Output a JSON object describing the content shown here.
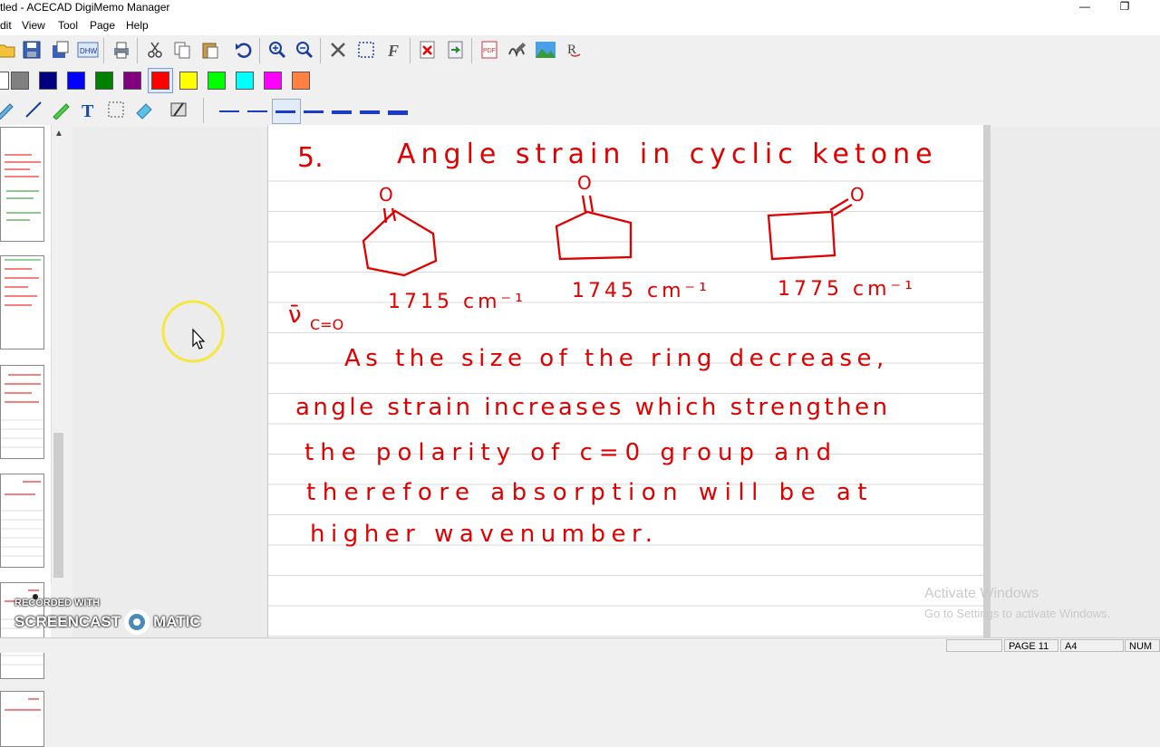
{
  "window": {
    "title": "tled - ACECAD DigiMemo Manager",
    "minimize": "—",
    "restore": "❐"
  },
  "menu": [
    "dit",
    "View",
    "Tool",
    "Page",
    "Help"
  ],
  "toolbar_icons": [
    "open-icon",
    "save-icon",
    "saveas-icon",
    "dhw-icon",
    "print-icon",
    "cut-icon",
    "copy-icon",
    "paste-icon",
    "undo-icon",
    "zoom-in-icon",
    "zoom-out-icon",
    "delete-icon",
    "select-icon",
    "font-icon",
    "close-file-icon",
    "export-icon",
    "pdf-icon",
    "convert-icon",
    "image-icon",
    "recognize-icon"
  ],
  "toolbar_labels": {
    "dhw": "DHW",
    "pdf": "PDF",
    "font": "F",
    "recog": "R"
  },
  "colors": [
    "#808080",
    "#000080",
    "#0000ff",
    "#008000",
    "#800080",
    "#ff0000",
    "#ffff00",
    "#00ff00",
    "#00ffff",
    "#ff00ff",
    "#ff8040"
  ],
  "tools": [
    "pen-icon",
    "line-icon",
    "highlighter-icon",
    "text-icon",
    "rect-select-icon",
    "eraser-icon",
    "clear-icon"
  ],
  "tool_text_label": "T",
  "line_widths": [
    1,
    1,
    2,
    2,
    3,
    3,
    4
  ],
  "note": {
    "heading_number": "5.",
    "heading": "Angle strain in cyclic ketone",
    "oxygen": "O",
    "nu_label": "ν̄",
    "nu_sub": "C=O",
    "freq1": "1715 cm⁻¹",
    "freq2": "1745 cm⁻¹",
    "freq3": "1775 cm⁻¹",
    "line1": "As the size of the ring decrease,",
    "line2": "angle strain increases which strengthen",
    "line3": "the polarity of c=0 group and",
    "line4": "therefore absorption will be at",
    "line5": "higher wavenumber."
  },
  "status": {
    "page": "PAGE 11",
    "size": "A4",
    "num": "NUM"
  },
  "watermark": {
    "line1": "Activate Windows",
    "line2": "Go to Settings to activate Windows."
  },
  "screencast": {
    "recorded": "RECORDED WITH",
    "brand_left": "SCREENCAST",
    "brand_right": "MATIC"
  }
}
